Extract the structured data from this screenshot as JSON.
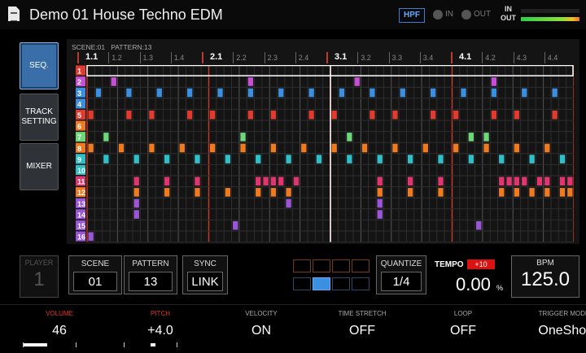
{
  "header": {
    "title": "Demo 01 House Techno EDM",
    "hpf_label": "HPF",
    "in_label": "IN",
    "out_label": "OUT",
    "meter_in_label": "IN",
    "meter_out_label": "OUT"
  },
  "sidebar": {
    "items": [
      {
        "label": "SEQ.",
        "active": true
      },
      {
        "label": "TRACK SETTING",
        "active": false
      },
      {
        "label": "MIXER",
        "active": false
      }
    ]
  },
  "sequencer": {
    "scene_label": "SCENE:01",
    "pattern_label": "PATTERN:13",
    "beats": [
      "1.1",
      "1.2",
      "1.3",
      "1.4",
      "2.1",
      "2.2",
      "2.3",
      "2.4",
      "3.1",
      "3.2",
      "3.3",
      "3.4",
      "4.1",
      "4.2",
      "4.3",
      "4.4"
    ],
    "tracks": [
      "1",
      "2",
      "3",
      "4",
      "5",
      "6",
      "7",
      "8",
      "9",
      "10",
      "11",
      "12",
      "13",
      "14",
      "15",
      "16"
    ],
    "track_colors": [
      "#e23b2e",
      "#c74fd6",
      "#3a8fe0",
      "#3a8fe0",
      "#e23b2e",
      "#f07a1e",
      "#6cd87a",
      "#f07a1e",
      "#2ec0c8",
      "#2ec0c8",
      "#e0356e",
      "#f07a1e",
      "#9b56d8",
      "#9b56d8",
      "#9b56d8",
      "#9b56d8"
    ],
    "playhead_step": 32,
    "selected_track": 1,
    "steps": {
      "2": [
        3,
        21,
        35,
        53
      ],
      "3": [
        1,
        5,
        9,
        13,
        17,
        21,
        25,
        29,
        33,
        37,
        41,
        45,
        49,
        53,
        57,
        61
      ],
      "5": [
        0,
        5,
        8,
        13,
        16,
        21,
        24,
        29,
        32,
        37,
        40,
        45,
        48,
        53,
        56,
        61
      ],
      "7": [
        2,
        20,
        34,
        50,
        52
      ],
      "8": [
        0,
        4,
        8,
        12,
        16,
        20,
        24,
        28,
        32,
        36,
        40,
        44,
        48,
        52,
        56,
        60
      ],
      "9": [
        2,
        6,
        10,
        14,
        18,
        22,
        26,
        30,
        34,
        38,
        42,
        46,
        50,
        54,
        58,
        62
      ],
      "11": [
        6,
        10,
        14,
        22,
        23,
        24,
        25,
        27,
        38,
        42,
        46,
        54,
        55,
        56,
        57,
        59,
        60,
        62,
        63
      ],
      "12": [
        6,
        10,
        14,
        18,
        22,
        24,
        26,
        38,
        42,
        46,
        54,
        56,
        58,
        60,
        62,
        63
      ],
      "13": [
        6,
        26,
        38
      ],
      "14": [
        6,
        38
      ],
      "15": [
        19,
        51
      ],
      "16": [
        0
      ]
    }
  },
  "bottom": {
    "player": {
      "label": "PLAYER",
      "value": "1"
    },
    "scene": {
      "label": "SCENE",
      "value": "01"
    },
    "pattern": {
      "label": "PATTERN",
      "value": "13"
    },
    "sync": {
      "label": "SYNC",
      "value": "LINK"
    },
    "quantize": {
      "label": "QUANTIZE",
      "value": "1/4"
    },
    "tempo": {
      "label": "TEMPO",
      "badge": "+10",
      "value": "0.00",
      "unit": "%"
    },
    "bpm": {
      "label": "BPM",
      "value": "125.0"
    }
  },
  "params": [
    {
      "label": "VOLUME",
      "value": "46",
      "label_color": "#e0352b",
      "level": 0.46
    },
    {
      "label": "PITCH",
      "value": "+4.0",
      "label_color": "#e0352b",
      "level": 0.6
    },
    {
      "label": "VELOCITY",
      "value": "ON",
      "label_color": "#aaaaaa"
    },
    {
      "label": "TIME STRETCH",
      "value": "OFF",
      "label_color": "#aaaaaa"
    },
    {
      "label": "LOOP",
      "value": "OFF",
      "label_color": "#aaaaaa"
    },
    {
      "label": "TRIGGER MODE",
      "value": "OneShot",
      "label_color": "#aaaaaa"
    }
  ],
  "colors": {
    "accent_blue": "#3a6ea8",
    "bar_line": "#c0392b",
    "meter_green": "#2bd24a"
  }
}
